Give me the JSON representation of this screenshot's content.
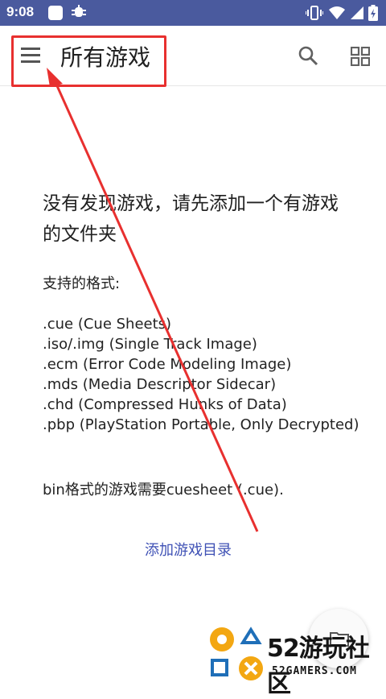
{
  "status_bar": {
    "time": "9:08",
    "icons": [
      "notification-square-icon",
      "bug-icon",
      "vibrate-icon",
      "wifi-icon",
      "signal-icon",
      "battery-icon"
    ],
    "background_color": "#4a5a9e"
  },
  "app_bar": {
    "title": "所有游戏",
    "icons": [
      "menu-icon",
      "search-icon",
      "grid-view-icon"
    ]
  },
  "empty_state": {
    "headline": "没有发现游戏，请先添加一个有游戏的文件夹",
    "formats_text": "支持的格式:\n\n.cue (Cue Sheets)\n.iso/.img (Single Track Image)\n.ecm (Error Code Modeling Image)\n.mds (Media Descriptor Sidecar)\n.chd (Compressed Hunks of Data)\n.pbp (PlayStation Portable, Only Decrypted)",
    "bin_note": "bin格式的游戏需要cuesheet (.cue).",
    "add_folder_label": "添加游戏目录",
    "link_color": "#3f51b5"
  },
  "fab": {
    "icon": "folder-icon"
  },
  "watermark": {
    "big_text": "52游玩社区",
    "small_text": "52GAMERS.COM",
    "accent_color": "#f3a712",
    "blue_color": "#1f6fb8"
  },
  "annotation": {
    "highlight_color": "#e8302f"
  }
}
